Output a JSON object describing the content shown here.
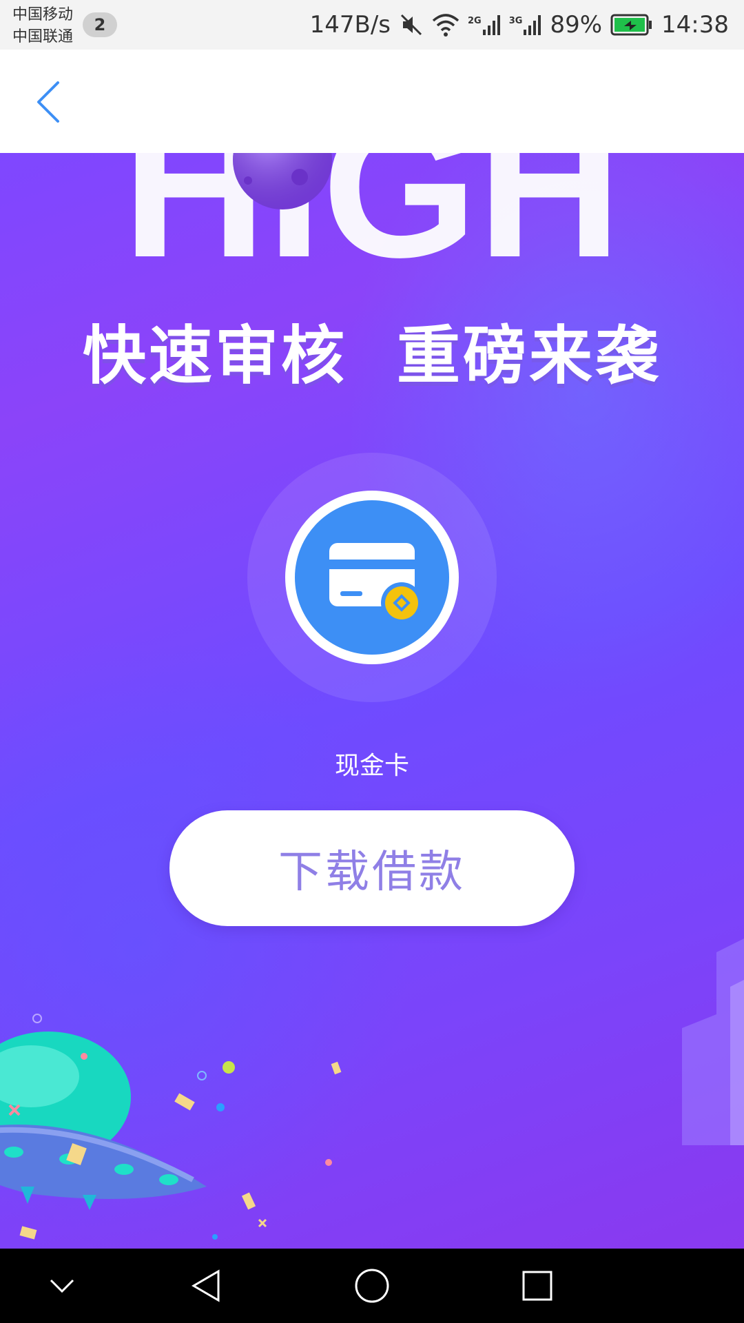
{
  "status_bar": {
    "carrier_1": "中国移动",
    "carrier_2": "中国联通",
    "notification_count": "2",
    "net_speed": "147B/s",
    "signal_1_label": "2G",
    "signal_2_label": "3G",
    "battery_percent": "89%",
    "time": "14:38"
  },
  "header": {
    "back_icon": "chevron-left-icon"
  },
  "banner": {
    "headline_letters": "HIGH",
    "slogan": "快速审核  重磅来袭",
    "product_icon": "credit-card-coin-icon",
    "product_name": "现金卡",
    "cta_label": "下载借款"
  },
  "nav_bar": {
    "icons": [
      "collapse-chevron-icon",
      "back-triangle-icon",
      "home-circle-icon",
      "recents-square-icon"
    ]
  },
  "colors": {
    "banner_purple": "#7f47ff",
    "icon_blue": "#3d8ff5",
    "coin_yellow": "#f4c20d",
    "cta_text": "#8f7fe6",
    "back_arrow": "#3d8ff5"
  }
}
